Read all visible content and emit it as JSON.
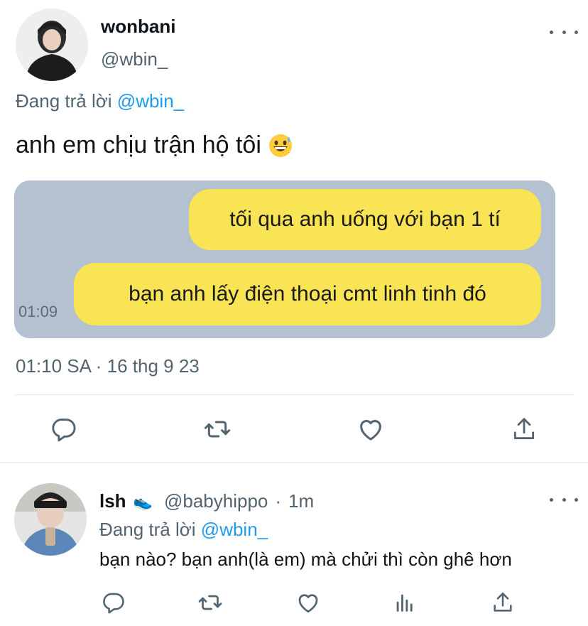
{
  "main_tweet": {
    "author_name": "wonbani",
    "author_handle": "@wbin_",
    "replying_prefix": "Đang trả lời",
    "replying_to": "@wbin_",
    "text": "anh em chịu trận hộ tôi",
    "emoji": "grinning-sweat-emoji",
    "timestamp": "01:10 SA · 16 thg 9 23",
    "media": {
      "bubbles": [
        "tối qua anh uống với bạn 1 tí",
        "bạn anh lấy điện thoại cmt linh tinh đó"
      ],
      "message_time": "01:09",
      "background_color": "#b3c1d1",
      "bubble_color": "#f8e455"
    },
    "actions": [
      "reply-icon",
      "retweet-icon",
      "like-icon",
      "share-icon"
    ]
  },
  "reply_tweet": {
    "author_name": "lsh",
    "author_emoji": "👟",
    "author_handle": "@babyhippo",
    "separator": "·",
    "time": "1m",
    "replying_prefix": "Đang trả lời",
    "replying_to": "@wbin_",
    "text": "bạn nào? bạn anh(là em) mà chửi thì còn ghê hơn",
    "actions": [
      "reply-icon",
      "retweet-icon",
      "like-icon",
      "analytics-icon",
      "share-icon"
    ]
  },
  "colors": {
    "accent": "#1d9bf0",
    "muted_text": "#536471",
    "divider": "#e6e9ec"
  }
}
